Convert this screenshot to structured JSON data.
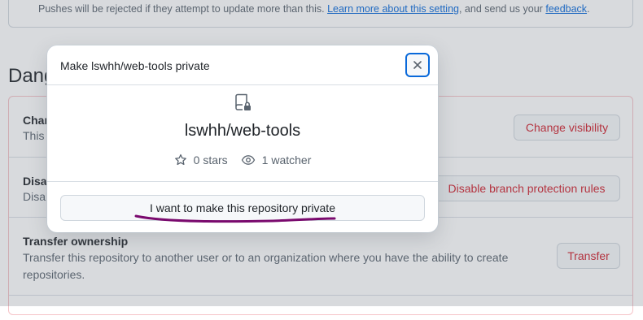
{
  "settings": {
    "push_note_text": "Pushes will be rejected if they attempt to update more than this.",
    "push_note_link": "Learn more about this setting",
    "push_note_mid": ", and send us your",
    "push_note_feedback": "feedback",
    "push_note_end": ".",
    "danger_zone_title": "Dang",
    "rows": [
      {
        "title": "Chan",
        "description": "This r",
        "button": "Change visibility"
      },
      {
        "title": "Disab",
        "description": "Disab",
        "button": "Disable branch protection rules"
      },
      {
        "title": "Transfer ownership",
        "description": "Transfer this repository to another user or to an organization where you have the ability to create repositories.",
        "button": "Transfer"
      }
    ]
  },
  "dialog": {
    "title": "Make lswhh/web-tools private",
    "close_icon": "x-icon",
    "repo_icon": "repo-locked-icon",
    "repo_name": "lswhh/web-tools",
    "stars_label": "0 stars",
    "watchers_label": "1 watcher",
    "confirm_label": "I want to make this repository private"
  },
  "colors": {
    "danger": "#cf222e",
    "link": "#0969da",
    "annotation": "#7a0a6e"
  }
}
